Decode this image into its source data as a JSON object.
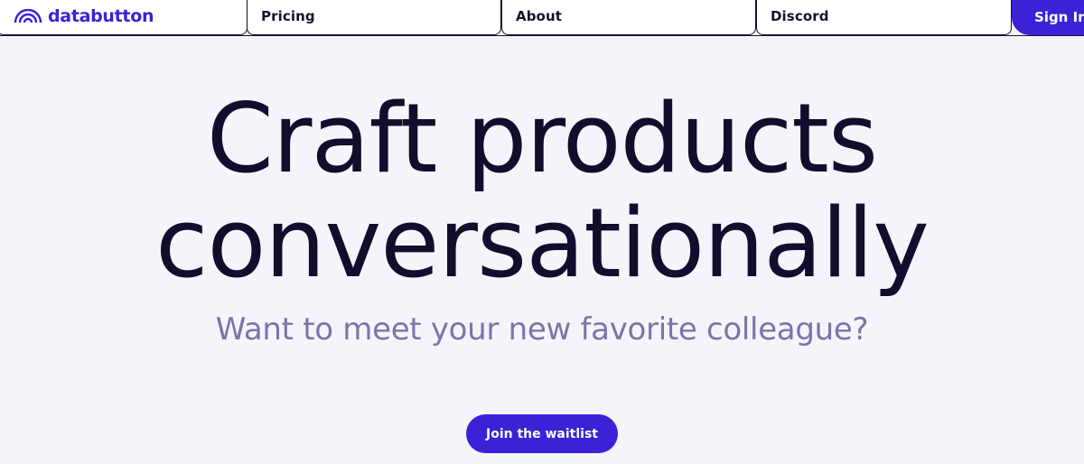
{
  "brand": {
    "name": "databutton",
    "icon": "rainbow-arc-icon",
    "color": "#3b22d6"
  },
  "nav": {
    "items": [
      {
        "label": "Pricing"
      },
      {
        "label": "About"
      },
      {
        "label": "Discord"
      }
    ],
    "sign_in_label": "Sign In"
  },
  "hero": {
    "title_line1": "Craft products",
    "title_line2": "conversationally",
    "subtitle": "Want to meet your new favorite colleague?",
    "cta_label": "Join the waitlist"
  },
  "colors": {
    "background": "#f6f4fb",
    "accent": "#3b22d6",
    "title": "#120d2c",
    "subtitle": "#7d74a8"
  }
}
